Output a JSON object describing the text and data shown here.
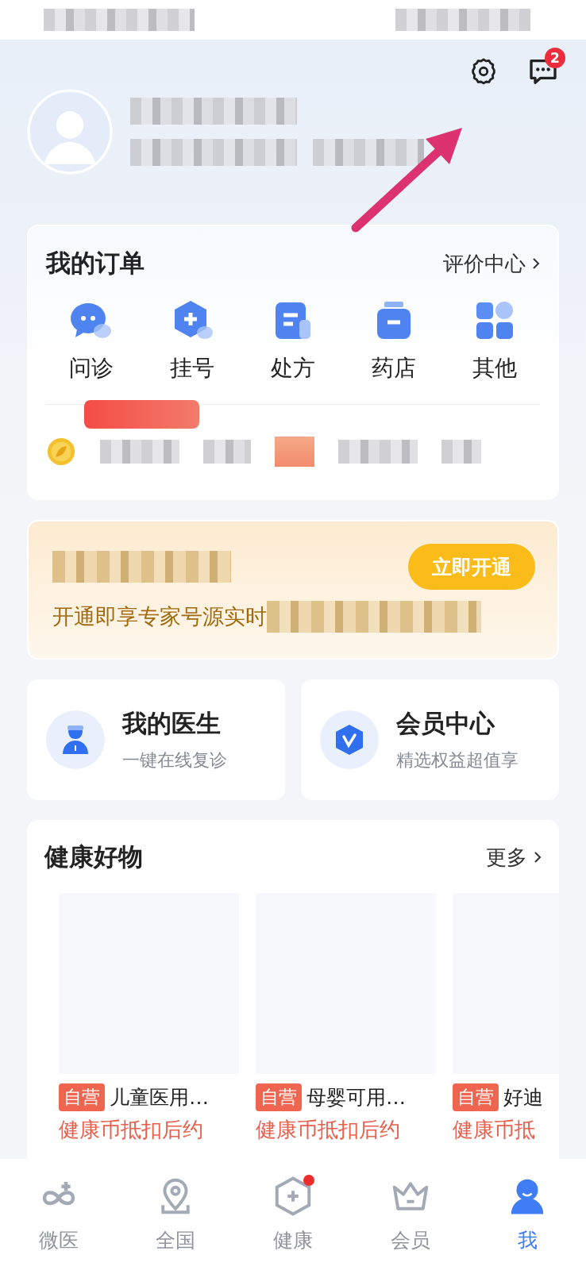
{
  "header": {
    "message_badge": "2"
  },
  "orders": {
    "title": "我的订单",
    "link": "评价中心",
    "items": [
      {
        "label": "问诊",
        "kind": "chat"
      },
      {
        "label": "挂号",
        "kind": "hexagon"
      },
      {
        "label": "处方",
        "kind": "document"
      },
      {
        "label": "药店",
        "kind": "jar"
      },
      {
        "label": "其他",
        "kind": "grid"
      }
    ]
  },
  "membership_banner": {
    "text": "开通即享专家号源实时",
    "button": "立即开通"
  },
  "shortcuts": [
    {
      "title": "我的医生",
      "subtitle": "一键在线复诊",
      "kind": "doctor"
    },
    {
      "title": "会员中心",
      "subtitle": "精选权益超值享",
      "kind": "member"
    }
  ],
  "goods": {
    "title": "健康好物",
    "more": "更多",
    "products": [
      {
        "tag": "自营",
        "name": "儿童医用…",
        "price_note": "健康币抵扣后约"
      },
      {
        "tag": "自营",
        "name": "母婴可用…",
        "price_note": "健康币抵扣后约"
      },
      {
        "tag": "自营",
        "name": "好迪",
        "price_note": "健康币抵"
      }
    ]
  },
  "tab_bar": [
    {
      "label": "微医",
      "kind": "logo",
      "selected": false,
      "dot": false
    },
    {
      "label": "全国",
      "kind": "pin",
      "selected": false,
      "dot": false
    },
    {
      "label": "健康",
      "kind": "hexplus",
      "selected": false,
      "dot": true
    },
    {
      "label": "会员",
      "kind": "crown",
      "selected": false,
      "dot": false
    },
    {
      "label": "我",
      "kind": "person",
      "selected": true,
      "dot": false
    }
  ]
}
